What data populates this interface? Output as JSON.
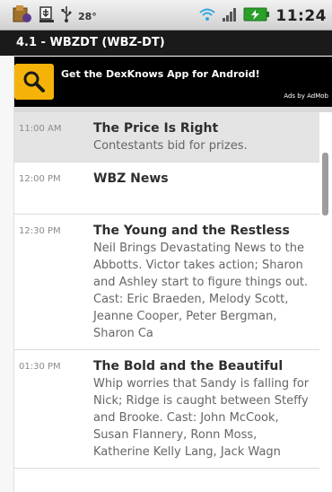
{
  "status_bar": {
    "temperature": "28°",
    "time": "11:24",
    "icons": [
      "app-notification-icon",
      "download-icon",
      "usb-icon",
      "wifi-icon",
      "signal-icon",
      "battery-icon"
    ]
  },
  "title_bar": {
    "title": "4.1 - WBZDT (WBZ-DT)"
  },
  "ad": {
    "text": "Get the DexKnows App for Android!",
    "byline": "Ads by AdMob",
    "icon": "search-icon",
    "accent_color": "#f5b30a"
  },
  "schedule": [
    {
      "time": "11:00 AM",
      "title": "The Price Is Right",
      "description": "Contestants bid for prizes.",
      "selected": true
    },
    {
      "time": "12:00 PM",
      "title": "WBZ News",
      "description": ""
    },
    {
      "time": "12:30 PM",
      "title": "The Young and the Restless",
      "description": "Neil Brings Devastating News to the Abbotts. Victor takes action; Sharon and Ashley start to figure things out. Cast: Eric Braeden, Melody Scott, Jeanne Cooper, Peter Bergman, Sharon Ca"
    },
    {
      "time": "01:30 PM",
      "title": "The Bold and the Beautiful",
      "description": "Whip worries that Sandy is falling for Nick; Ridge is caught between Steffy and Brooke. Cast: John McCook, Susan Flannery, Ronn Moss, Katherine Kelly Lang, Jack Wagn"
    }
  ]
}
